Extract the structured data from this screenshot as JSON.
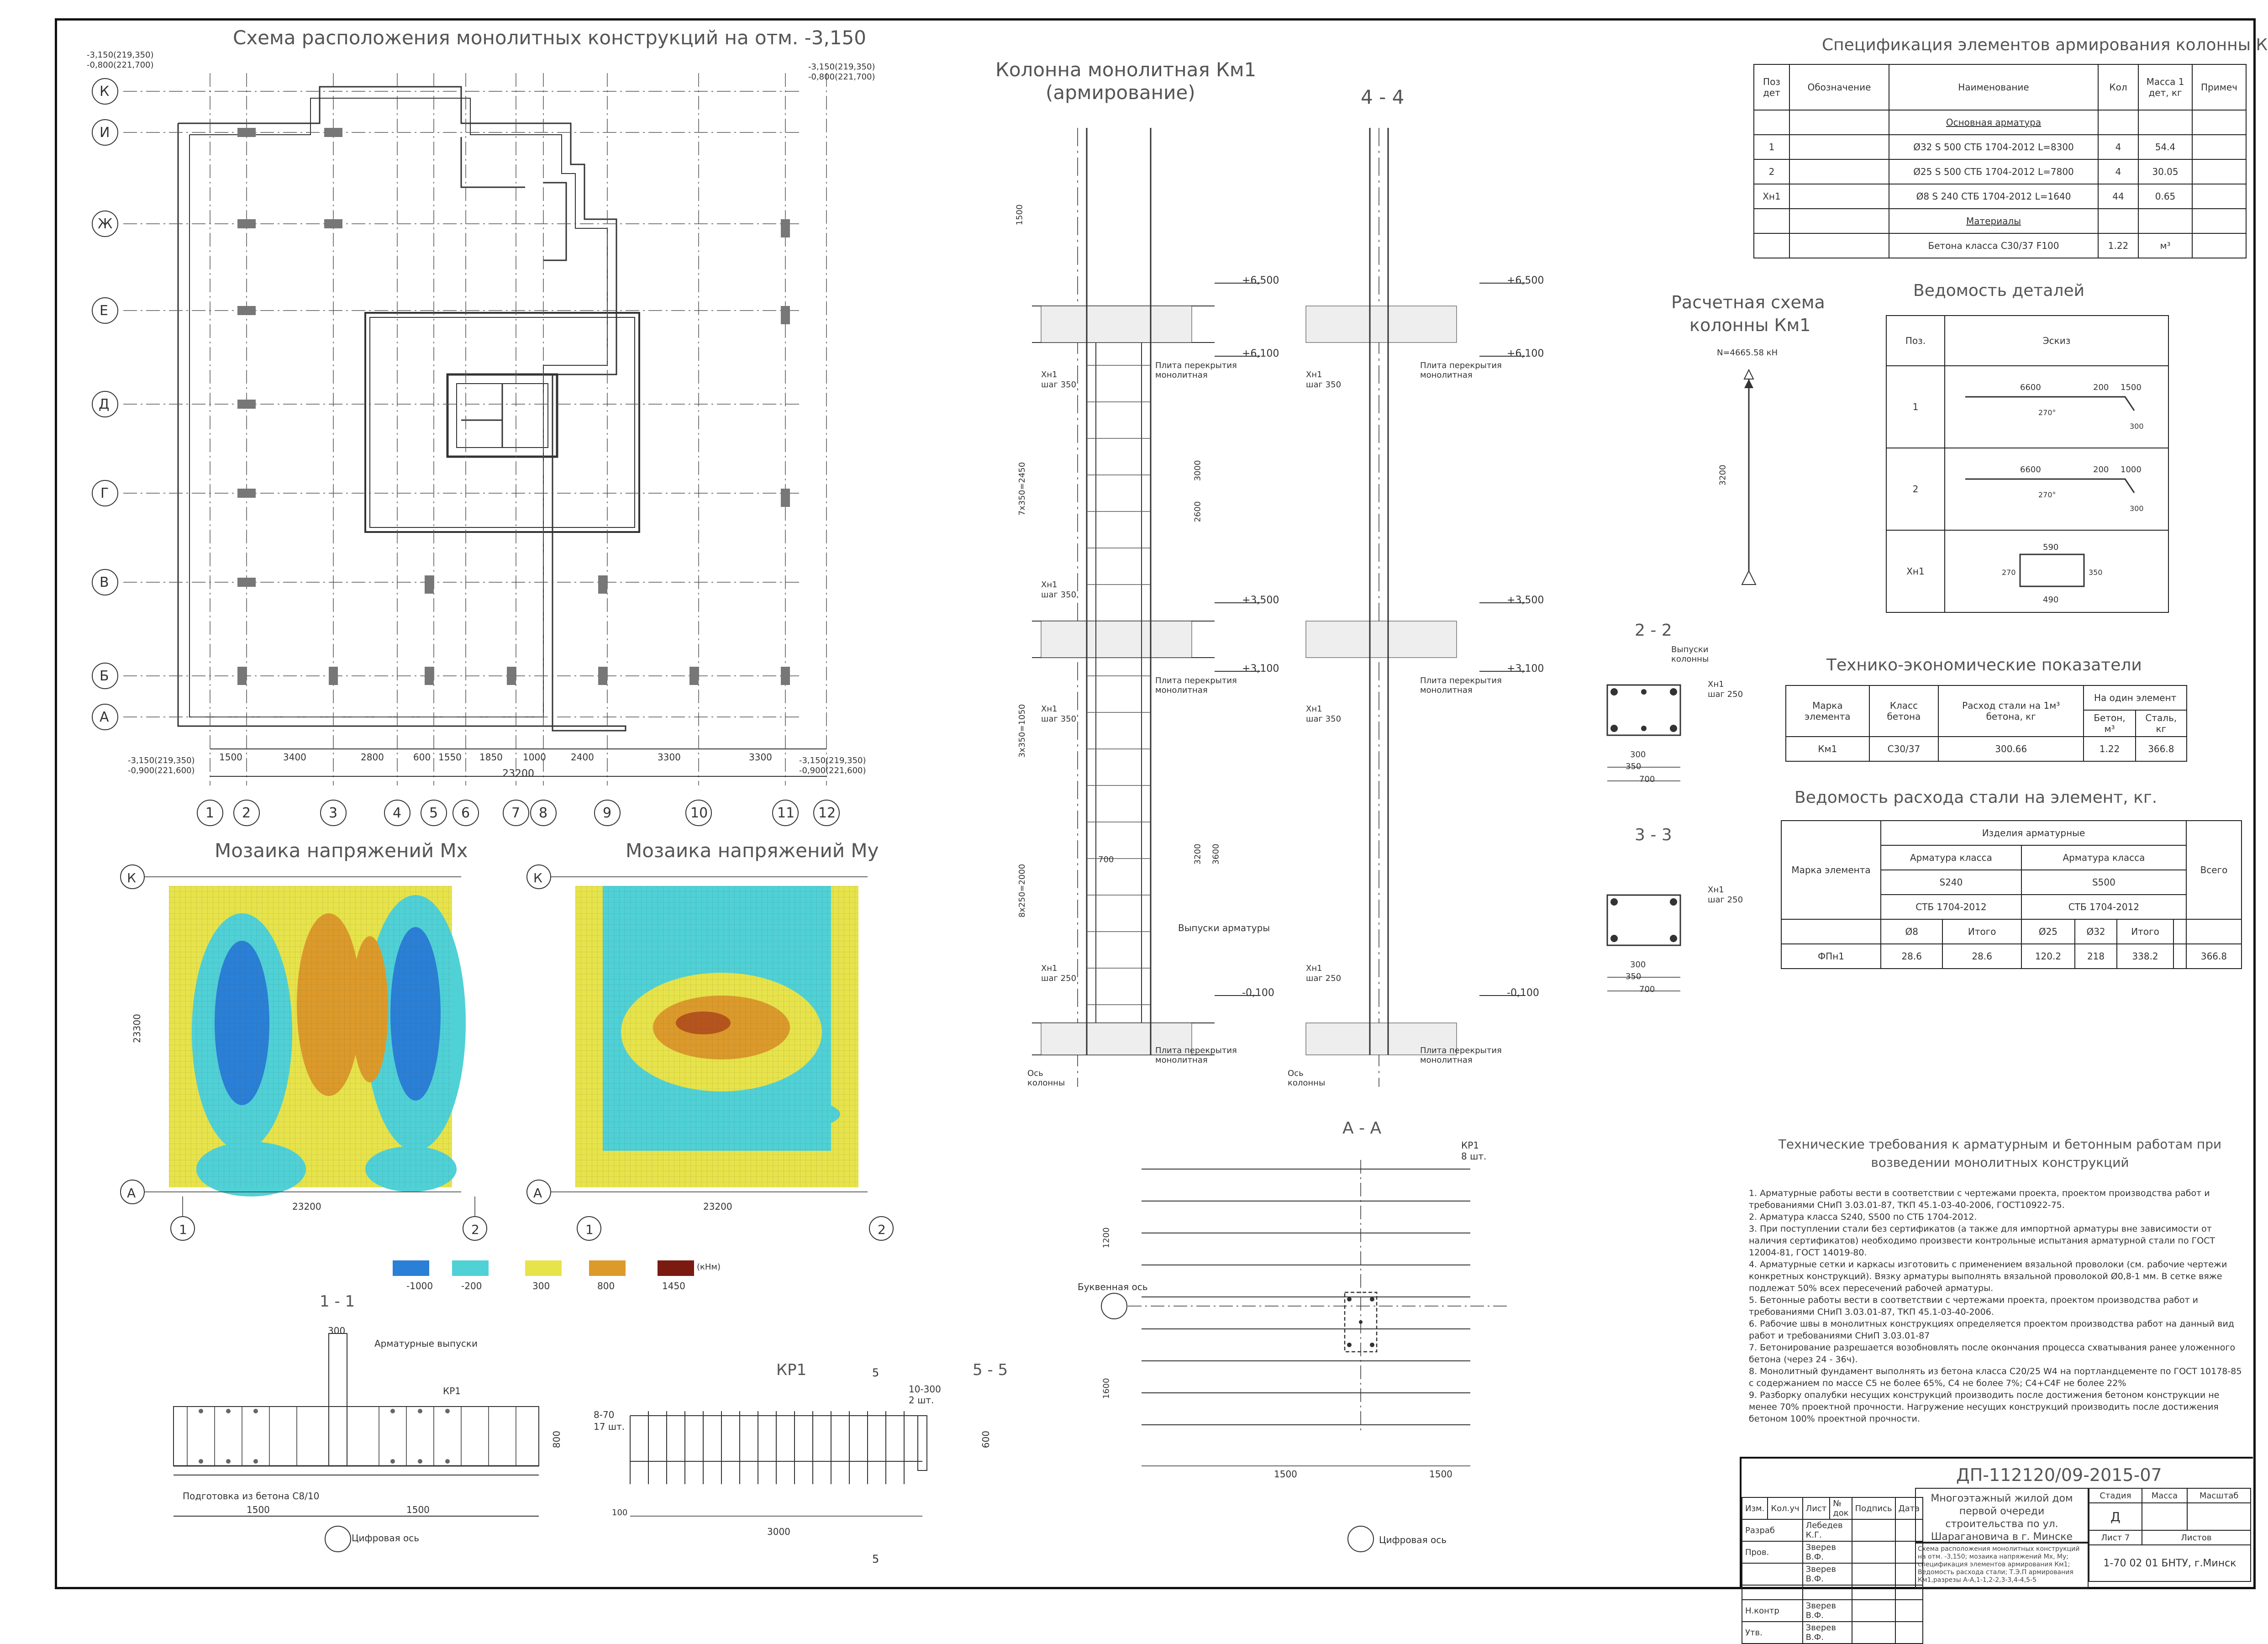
{
  "plan": {
    "title": "Схема расположения монолитных конструкций на отм. -3,150",
    "axes_rows": [
      "К",
      "И",
      "Ж",
      "Е",
      "Д",
      "Г",
      "В",
      "Б",
      "А"
    ],
    "axes_cols": [
      "1",
      "2",
      "3",
      "4",
      "5",
      "6",
      "7",
      "8",
      "9",
      "10",
      "11",
      "12"
    ],
    "bottom_dims": [
      "1500",
      "3400",
      "2800",
      "600",
      "1550",
      "1850",
      "1000",
      "2400",
      "3300",
      "3300"
    ],
    "total": "23200",
    "corner_marks": [
      "-3,150(219,350)",
      "-0,800(221,700)",
      "-3,150(219,350)",
      "-0,800(221,700)",
      "-3,150(219,350)",
      "-0,900(221,600)",
      "-3,150(219,350)",
      "-0,900(221,600)"
    ]
  },
  "column": {
    "title": "Колонна монолитная Км1",
    "subtitle": "(армирование)",
    "section_title": "4 - 4",
    "levels": [
      "+6,500",
      "+6,100",
      "+3,500",
      "+3,100",
      "-0,100"
    ],
    "labels": {
      "slab": "Плита перекрытия монолитная",
      "outlets": "Выпуски арматуры",
      "axis": "Ось колонны",
      "mesh1": "Хн1",
      "step350": "шаг 350",
      "step250": "шаг 250"
    },
    "dims": [
      "1500",
      "7х350=2450",
      "3х350=1050",
      "8х250=2000",
      "3000",
      "3600",
      "3200",
      "2600",
      "700"
    ]
  },
  "spec": {
    "title": "Спецификация элементов армирования колонны Км1",
    "headers": [
      "Поз дет",
      "Обозначение",
      "Наименование",
      "Кол",
      "Масса 1 дет, кг",
      "Примеч"
    ],
    "section1": "Основная арматура",
    "rows": [
      [
        "1",
        "",
        "Ø32 S 500 СТБ 1704-2012 L=8300",
        "4",
        "54.4",
        ""
      ],
      [
        "2",
        "",
        "Ø25 S 500 СТБ 1704-2012 L=7800",
        "4",
        "30.05",
        ""
      ],
      [
        "Хн1",
        "",
        "Ø8 S 240 СТБ 1704-2012 L=1640",
        "44",
        "0.65",
        ""
      ]
    ],
    "section2": "Материалы",
    "mat": [
      "",
      "",
      "Бетона класса С30/37 F100",
      "1.22",
      "м³",
      ""
    ]
  },
  "calc": {
    "title1": "Расчетная схема",
    "title2": "колонны Км1",
    "force": "N=4665.58 кН",
    "length": "3200"
  },
  "details": {
    "title": "Ведомость деталей",
    "h1": "Поз.",
    "h2": "Эскиз",
    "rows": [
      {
        "pos": "1",
        "d": [
          "6600",
          "200",
          "1500",
          "270°",
          "300"
        ]
      },
      {
        "pos": "2",
        "d": [
          "6600",
          "200",
          "1000",
          "270°",
          "300"
        ]
      },
      {
        "pos": "Хн1",
        "d": [
          "590",
          "270",
          "490",
          "350"
        ]
      }
    ]
  },
  "tep": {
    "title": "Технико-экономические показатели",
    "h": [
      "Марка элемента",
      "Класс бетона",
      "Расход стали на 1м³ бетона, кг",
      "На один элемент",
      "Бетон, м³",
      "Сталь, кг"
    ],
    "row": [
      "Км1",
      "С30/37",
      "300.66",
      "1.22",
      "366.8"
    ]
  },
  "steel": {
    "title": "Ведомость расхода стали на элемент, кг.",
    "h": [
      "Марка элемента",
      "Изделия арматурные",
      "Арматура класса",
      "S240",
      "S500",
      "СТБ 1704-2012",
      "Ø8",
      "Итого",
      "Ø25",
      "Ø32",
      "Всего"
    ],
    "row": [
      "ФПн1",
      "28.6",
      "28.6",
      "120.2",
      "218",
      "338.2",
      "366.8"
    ]
  },
  "sec22": {
    "title": "2 - 2",
    "labels": [
      "Выпуски колонны",
      "Хн1",
      "шаг 250",
      "300",
      "350",
      "700",
      "50"
    ]
  },
  "sec33": {
    "title": "3 - 3",
    "labels": [
      "Хн1",
      "шаг 250",
      "300",
      "350",
      "700",
      "50"
    ]
  },
  "mosaicX": {
    "title": "Мозаика напряжений Mx",
    "dim_h": "23200",
    "dim_v": "23300",
    "axes": [
      "К",
      "А",
      "1",
      "2"
    ]
  },
  "mosaicY": {
    "title": "Мозаика напряжений My",
    "dim_h": "23200",
    "dim_v": "23300",
    "axes": [
      "К",
      "А",
      "1",
      "2"
    ]
  },
  "legend": {
    "unit": "(кНм)",
    "items": [
      {
        "v": "-1000",
        "c": "#2a7fd6"
      },
      {
        "v": "-200",
        "c": "#4fd1d6"
      },
      {
        "v": "300",
        "c": "#e7e34a"
      },
      {
        "v": "800",
        "c": "#dc9a2a"
      },
      {
        "v": "1450",
        "c": "#7a1a10"
      }
    ]
  },
  "sec11": {
    "title": "1 - 1",
    "labels": [
      "Арматурные выпуски",
      "КР1",
      "Подготовка из бетона С8/10",
      "Цифровая ось",
      "1500",
      "1500",
      "300",
      "800"
    ]
  },
  "kr1": {
    "title": "КР1",
    "labels": [
      "8-70",
      "17 шт.",
      "10-300",
      "2 шт.",
      "3000",
      "600",
      "100",
      "5",
      "5"
    ]
  },
  "sec55": {
    "title": "5 - 5"
  },
  "aa": {
    "title": "А - А",
    "labels": [
      "КР1",
      "8 шт.",
      "Буквенная ось",
      "Цифровая ось",
      "1500",
      "1500",
      "1200",
      "1600"
    ]
  },
  "notes": {
    "title": "Технические требования к арматурным и бетонным работам при возведении монолитных конструкций",
    "items": [
      "1. Арматурные работы вести в соответствии с чертежами проекта, проектом производства работ и требованиями СНиП 3.03.01-87, ТКП 45.1-03-40-2006, ГОСТ10922-75.",
      "2. Арматура класса S240, S500 по СТБ 1704-2012.",
      "3. При поступлении стали без сертификатов (а также для импортной арматуры вне зависимости от наличия сертификатов) необходимо произвести контрольные испытания арматурной стали по ГОСТ 12004-81, ГОСТ 14019-80.",
      "4. Арматурные сетки и каркасы изготовить с применением вязальной проволоки (см. рабочие чертежи конкретных конструкций). Вязку арматуры выполнять вязальной проволокой Ø0,8-1 мм. В сетке вяже подлежат 50% всех пересечений рабочей арматуры.",
      "5. Бетонные работы вести в соответствии с чертежами проекта, проектом производства работ и требованиями СНиП 3.03.01-87, ТКП 45.1-03-40-2006.",
      "6. Рабочие швы в монолитных конструкциях определяется проектом производства работ на данный вид работ и требованиями СНиП 3.03.01-87",
      "7. Бетонирование разрешается возобновлять после окончания процесса схватывания ранее уложенного бетона (через 24 - 36ч).",
      "8. Монолитный фундамент выполнять из бетона класса С20/25 W4 на портландцементе по ГОСТ 10178-85 с содержанием по массе С5 не более 65%, С4 не более 7%; С4+С4F не более 22%",
      "9. Разборку опалубки несущих конструкций производить после достижения бетоном конструкции не менее 70% проектной прочности. Нагружение несущих конструкций производить после достижения бетоном 100% проектной прочности."
    ]
  },
  "stamp": {
    "code": "ДП-112120/09-2015-07",
    "project": "Многоэтажный жилой дом первой очереди строительства по ул. Шарагановича в г. Минске",
    "sheet_desc": "Схема расположения монолитных конструкций на отм. -3,150; мозаика напряжений Мх, Му; спецификация элементов армирования Км1; Ведомость расхода стали; Т.Э.П армирования Км1,разрезы А-А,1-1,2-2,3-3,4-4,5-5",
    "hdr": [
      "Изм.",
      "Кол.уч",
      "Лист",
      "№ док",
      "Подпись",
      "Дата"
    ],
    "roles": [
      [
        "Разраб",
        "Лебедев К.Г."
      ],
      [
        "Пров.",
        "Зверев В.Ф."
      ],
      [
        "",
        "Зверев В.Ф."
      ],
      [
        "Н.контр",
        "Зверев В.Ф."
      ],
      [
        "Утв.",
        "Зверев В.Ф."
      ]
    ],
    "stage_h": [
      "Стадия",
      "Масса",
      "Масштаб"
    ],
    "stage": "Д",
    "sheet": "Лист 7",
    "sheets": "Листов",
    "org": "1-70 02 01 БНТУ, г.Минск"
  }
}
